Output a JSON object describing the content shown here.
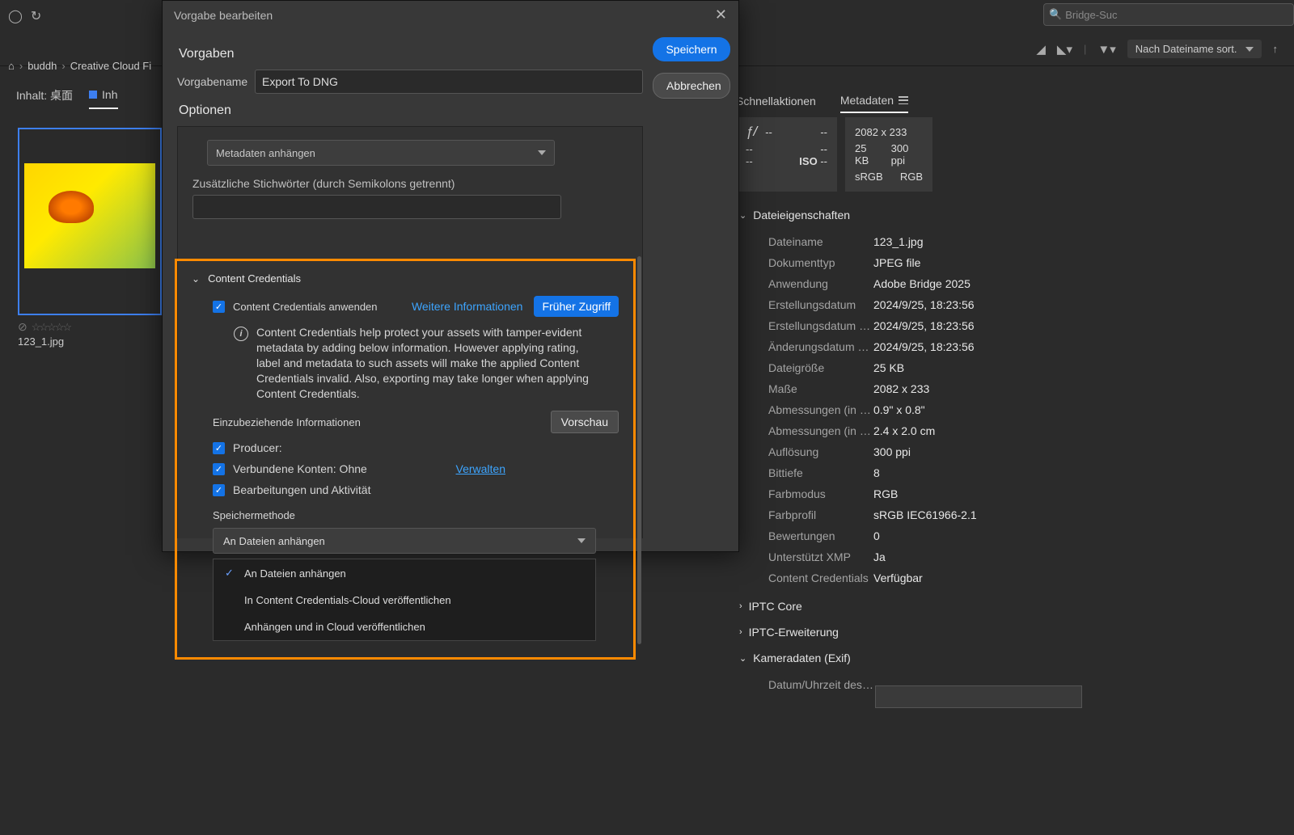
{
  "search": {
    "placeholder": "Bridge-Suc"
  },
  "sort": {
    "label": "Nach Dateiname sort."
  },
  "breadcrumb": {
    "items": [
      "buddh",
      "Creative Cloud Fi"
    ]
  },
  "tabs": {
    "content_label": "Inhalt:  桌面",
    "content_tab": "Inh"
  },
  "right_tabs": {
    "quick": "Schnellaktionen",
    "meta": "Metadaten"
  },
  "thumbnail": {
    "filename": "123_1.jpg",
    "rating_empty": "☆☆☆☆☆"
  },
  "quickinfo": {
    "aperture_label": "ƒ/",
    "a1": "--",
    "a2": "--",
    "row2a": "--",
    "row2b": "--",
    "row3a": "--",
    "iso_label": "ISO",
    "iso_val": "--",
    "dim": "2082 x 233",
    "size": "25 KB",
    "ppi": "300 ppi",
    "cs": "sRGB",
    "mode": "RGB"
  },
  "meta_sections": {
    "fileprops": "Dateieigenschaften",
    "iptc_core": "IPTC Core",
    "iptc_ext": "IPTC-Erweiterung",
    "exif": "Kameradaten (Exif)",
    "last": "Datum/Uhrzeit des Or"
  },
  "fileprops": [
    {
      "l": "Dateiname",
      "v": "123_1.jpg"
    },
    {
      "l": "Dokumenttyp",
      "v": "JPEG file"
    },
    {
      "l": "Anwendung",
      "v": "Adobe Bridge 2025"
    },
    {
      "l": "Erstellungsdatum",
      "v": "2024/9/25, 18:23:56"
    },
    {
      "l": "Erstellungsdatum der...",
      "v": "2024/9/25, 18:23:56"
    },
    {
      "l": "Änderungsdatum der ...",
      "v": "2024/9/25, 18:23:56"
    },
    {
      "l": "Dateigröße",
      "v": "25 KB"
    },
    {
      "l": "Maße",
      "v": "2082 x 233"
    },
    {
      "l": "Abmessungen (in Zoll)",
      "v": "0.9\" x 0.8\""
    },
    {
      "l": "Abmessungen (in cm)",
      "v": "2.4  x 2.0 cm"
    },
    {
      "l": "Auflösung",
      "v": "300 ppi"
    },
    {
      "l": "Bittiefe",
      "v": "8"
    },
    {
      "l": "Farbmodus",
      "v": "RGB"
    },
    {
      "l": "Farbprofil",
      "v": "sRGB IEC61966-2.1"
    },
    {
      "l": "Bewertungen",
      "v": "0"
    },
    {
      "l": "Unterstützt XMP",
      "v": "Ja"
    },
    {
      "l": "Content Credentials",
      "v": "Verfügbar"
    }
  ],
  "dialog": {
    "title": "Vorgabe bearbeiten",
    "section_presets": "Vorgaben",
    "preset_name_label": "Vorgabename",
    "preset_name_value": "Export To DNG",
    "save": "Speichern",
    "cancel": "Abbrechen",
    "section_options": "Optionen",
    "metadata_dropdown": "Metadaten anhängen",
    "keywords_label": "Zusätzliche Stichwörter (durch Semikolons getrennt)",
    "cc_section": "Content Credentials",
    "cc_apply": "Content Credentials anwenden",
    "cc_more": "Weitere Informationen",
    "cc_early": "Früher Zugriff",
    "cc_desc": "Content Credentials help protect your assets with tamper-evident metadata by adding below information. However applying rating, label and metadata to such assets will make the applied Content Credentials invalid. Also, exporting may take longer when applying Content Credentials.",
    "cc_include": "Einzubeziehende Informationen",
    "preview": "Vorschau",
    "producer": "Producer:",
    "accounts": "Verbundene Konten: Ohne",
    "manage": "Verwalten",
    "edits": "Bearbeitungen und Aktivität",
    "store_label": "Speichermethode",
    "store_selected": "An Dateien anhängen",
    "store_options": [
      "An Dateien anhängen",
      "In Content Credentials-Cloud veröffentlichen",
      "Anhängen und in Cloud veröffentlichen"
    ]
  }
}
